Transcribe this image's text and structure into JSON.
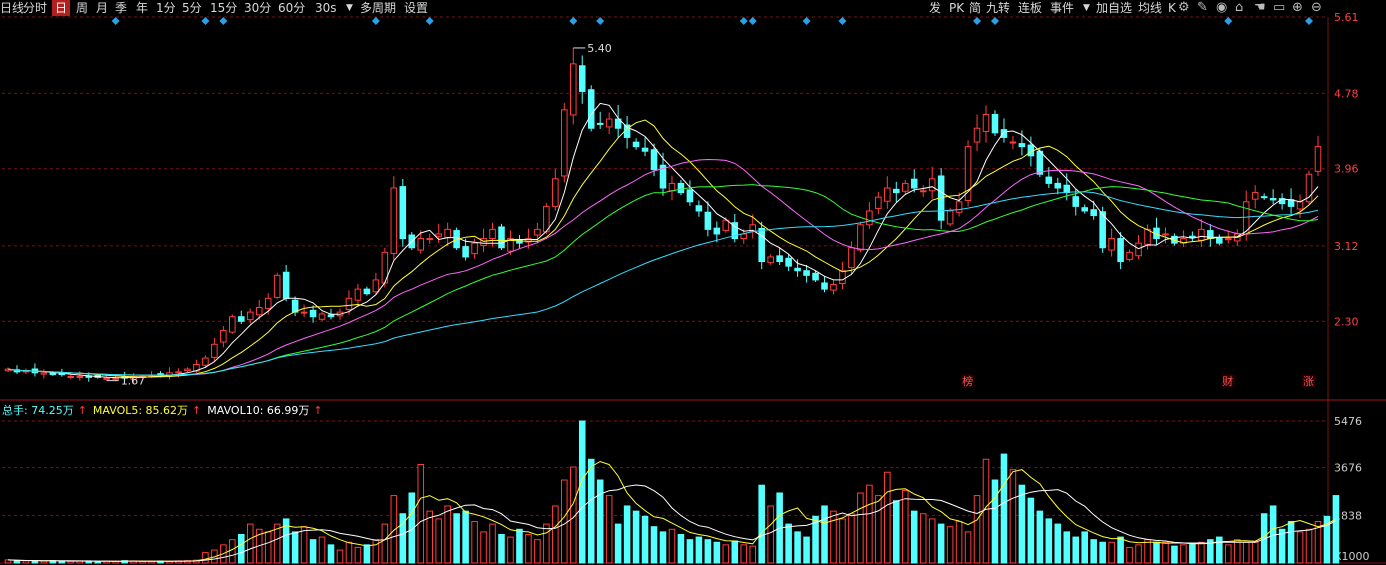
{
  "toolbar": {
    "left_items": [
      {
        "label": "日线",
        "x": 0
      },
      {
        "label": "分时",
        "x": 23
      },
      {
        "label": "日",
        "x": 52,
        "selected": true
      },
      {
        "label": "周",
        "x": 76
      },
      {
        "label": "月",
        "x": 96
      },
      {
        "label": "季",
        "x": 115
      },
      {
        "label": "年",
        "x": 136
      },
      {
        "label": "1分",
        "x": 156
      },
      {
        "label": "5分",
        "x": 182
      },
      {
        "label": "15分",
        "x": 210
      },
      {
        "label": "30分",
        "x": 244
      },
      {
        "label": "60分",
        "x": 278
      },
      {
        "label": "30s",
        "x": 315
      },
      {
        "label": "多周期",
        "x": 360
      },
      {
        "label": "设置",
        "x": 404
      }
    ],
    "right_items": [
      {
        "label": "发",
        "x": 929
      },
      {
        "label": "PK",
        "x": 949
      },
      {
        "label": "简",
        "x": 969
      },
      {
        "label": "九转",
        "x": 986
      },
      {
        "label": "连板",
        "x": 1018
      },
      {
        "label": "事件",
        "x": 1050
      },
      {
        "label": "加自选",
        "x": 1096
      },
      {
        "label": "均线",
        "x": 1138
      },
      {
        "label": "K",
        "x": 1168
      }
    ],
    "icons": [
      "gear-icon",
      "pen-icon",
      "eye-icon",
      "home-icon",
      "hand-icon",
      "restore-icon",
      "zoom-in-icon",
      "zoom-out-icon"
    ]
  },
  "colors": {
    "up": "#ff3c3c",
    "down": "#54ffff",
    "grid": "#7a1414",
    "axis_text_price": "#ff4040",
    "ma5": "#ffffff",
    "ma10": "#ffff33",
    "ma20": "#ff66ff",
    "ma30": "#33ff33",
    "ma60": "#33ddff",
    "marker": "#2aa0e6"
  },
  "chart_data": [
    {
      "type": "candlestick",
      "price_ticks": [
        "5.61",
        "4.78",
        "3.96",
        "3.12",
        "2.30"
      ],
      "ylim": [
        1.56,
        5.61
      ],
      "max_label": "5.40",
      "min_label": "1.67",
      "event_labels": [
        {
          "text": "榜",
          "bar": 107
        },
        {
          "text": "财",
          "bar": 136
        },
        {
          "text": "涨",
          "bar": 145
        }
      ],
      "marker_bars": [
        12,
        22,
        24,
        41,
        47,
        63,
        66,
        82,
        83,
        89,
        93,
        108,
        110,
        136,
        145
      ],
      "ma_lines": [
        "ma5",
        "ma10",
        "ma20",
        "ma30",
        "ma60"
      ],
      "closes": [
        1.78,
        1.75,
        1.76,
        1.74,
        1.74,
        1.72,
        1.72,
        1.7,
        1.7,
        1.69,
        1.69,
        1.68,
        1.68,
        1.69,
        1.7,
        1.7,
        1.71,
        1.72,
        1.74,
        1.75,
        1.78,
        1.83,
        1.9,
        2.05,
        2.2,
        2.35,
        2.3,
        2.4,
        2.45,
        2.55,
        2.8,
        2.55,
        2.4,
        2.4,
        2.35,
        2.38,
        2.35,
        2.4,
        2.55,
        2.65,
        2.6,
        2.75,
        3.05,
        3.75,
        3.2,
        3.1,
        3.2,
        3.2,
        3.25,
        3.3,
        3.1,
        3.0,
        3.15,
        3.2,
        3.3,
        3.1,
        3.2,
        3.15,
        3.2,
        3.3,
        3.55,
        3.85,
        4.6,
        5.1,
        4.8,
        4.4,
        4.45,
        4.5,
        4.4,
        4.3,
        4.2,
        4.15,
        3.95,
        3.75,
        3.8,
        3.7,
        3.6,
        3.5,
        3.3,
        3.25,
        3.4,
        3.2,
        3.25,
        3.35,
        2.95,
        3.0,
        2.95,
        2.9,
        2.85,
        2.8,
        2.75,
        2.65,
        2.7,
        2.85,
        3.1,
        3.35,
        3.5,
        3.65,
        3.75,
        3.7,
        3.8,
        3.75,
        3.72,
        3.85,
        3.4,
        3.5,
        3.6,
        4.2,
        4.4,
        4.55,
        4.35,
        4.3,
        4.25,
        4.2,
        4.1,
        3.9,
        3.8,
        3.75,
        3.7,
        3.55,
        3.5,
        3.45,
        3.1,
        3.2,
        2.95,
        3.05,
        3.15,
        3.3,
        3.2,
        3.25,
        3.15,
        3.2,
        3.22,
        3.3,
        3.2,
        3.15,
        3.2,
        3.25,
        3.6,
        3.7,
        3.65,
        3.62,
        3.58,
        3.55,
        3.6,
        3.9,
        4.2
      ],
      "volume": {
        "ticks": [
          "5476",
          "3676",
          "1838"
        ],
        "unit": "X1000",
        "ylim": [
          0,
          5476
        ],
        "legend": [
          {
            "label": "总手: 74.25万",
            "color": "#54ffff"
          },
          {
            "label": "MAVOL5: 85.62万",
            "color": "#ffff33"
          },
          {
            "label": "MAVOL10: 66.99万",
            "color": "#ffffff"
          }
        ],
        "values": [
          120,
          90,
          80,
          85,
          70,
          90,
          60,
          70,
          80,
          60,
          55,
          75,
          60,
          90,
          80,
          70,
          60,
          75,
          70,
          80,
          90,
          110,
          400,
          500,
          700,
          900,
          1100,
          1500,
          1300,
          1200,
          1500,
          1700,
          1200,
          1400,
          900,
          1000,
          700,
          500,
          800,
          600,
          700,
          900,
          1500,
          2600,
          1900,
          2700,
          3800,
          2000,
          1700,
          2200,
          1900,
          2000,
          1600,
          1200,
          1500,
          1100,
          1000,
          1300,
          1100,
          900,
          1500,
          2200,
          3200,
          3700,
          5476,
          4000,
          3200,
          2600,
          1500,
          2200,
          2000,
          1800,
          1400,
          1200,
          1300,
          1100,
          900,
          1000,
          900,
          800,
          700,
          850,
          700,
          650,
          3000,
          2200,
          2700,
          1500,
          1200,
          1000,
          1800,
          2200,
          2000,
          1700,
          1900,
          2700,
          3000,
          2600,
          3500,
          2400,
          2800,
          2000,
          1900,
          1700,
          1500,
          1400,
          1600,
          1200,
          2600,
          4000,
          3200,
          4200,
          3600,
          3000,
          2500,
          2000,
          1700,
          1500,
          1200,
          1000,
          1200,
          900,
          800,
          800,
          1000,
          600,
          700,
          900,
          800,
          800,
          650,
          700,
          750,
          800,
          900,
          1000,
          700,
          900,
          800,
          800,
          1900,
          2200,
          1300,
          1600,
          1200,
          1300,
          1600,
          1800,
          2600
        ]
      }
    }
  ]
}
